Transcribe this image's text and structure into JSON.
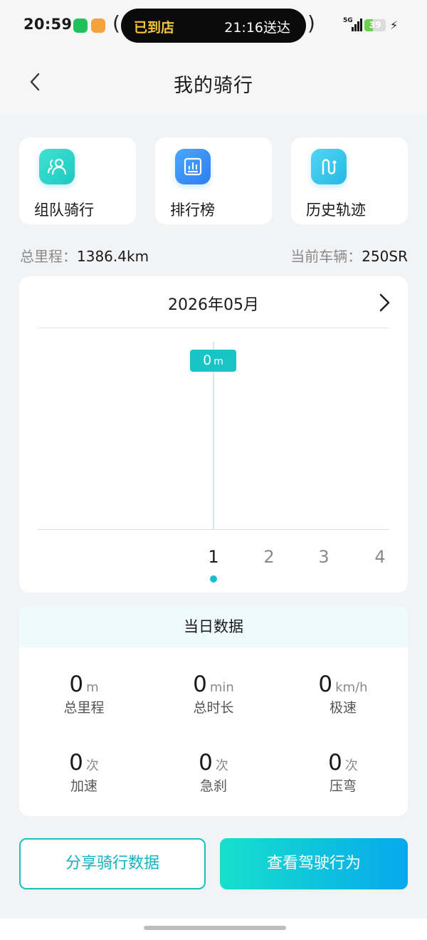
{
  "status_bar": {
    "time": "20:59",
    "island_left": "已到店",
    "island_right": "21:16送达",
    "network": "5G",
    "battery": "39",
    "battery_level": 0.39
  },
  "header": {
    "title": "我的骑行",
    "back_icon": "chevron-left-icon"
  },
  "features": [
    {
      "label": "组队骑行",
      "icon": "group-users-icon",
      "color": "#2fd6c7"
    },
    {
      "label": "排行榜",
      "icon": "ranking-chart-icon",
      "color": "#3a8ef5"
    },
    {
      "label": "历史轨迹",
      "icon": "route-track-icon",
      "color": "#36c8ea"
    }
  ],
  "summary": {
    "total_label": "总里程：",
    "total_value": "1386.4km",
    "vehicle_label": "当前车辆：",
    "vehicle_value": "250SR"
  },
  "chart": {
    "month": "2026年05月",
    "next_icon": "chevron-right-icon",
    "tooltip_value": "0",
    "tooltip_unit": "m",
    "days": [
      "1",
      "2",
      "3",
      "4"
    ],
    "selected_day": "1"
  },
  "chart_data": {
    "type": "bar",
    "categories": [
      "1",
      "2",
      "3",
      "4"
    ],
    "values": [
      0
    ],
    "title": "2026年05月",
    "xlabel": "",
    "ylabel": ""
  },
  "daily": {
    "title": "当日数据",
    "stats": [
      {
        "value": "0",
        "unit": "m",
        "label": "总里程"
      },
      {
        "value": "0",
        "unit": "min",
        "label": "总时长"
      },
      {
        "value": "0",
        "unit": "km/h",
        "label": "极速"
      },
      {
        "value": "0",
        "unit": "次",
        "label": "加速"
      },
      {
        "value": "0",
        "unit": "次",
        "label": "急刹"
      },
      {
        "value": "0",
        "unit": "次",
        "label": "压弯"
      }
    ]
  },
  "actions": {
    "share_label": "分享骑行数据",
    "behavior_label": "查看驾驶行为"
  },
  "colors": {
    "accent": "#19c4c6",
    "button_gradient_start": "#16e0cc",
    "button_gradient_end": "#07a8ec"
  }
}
